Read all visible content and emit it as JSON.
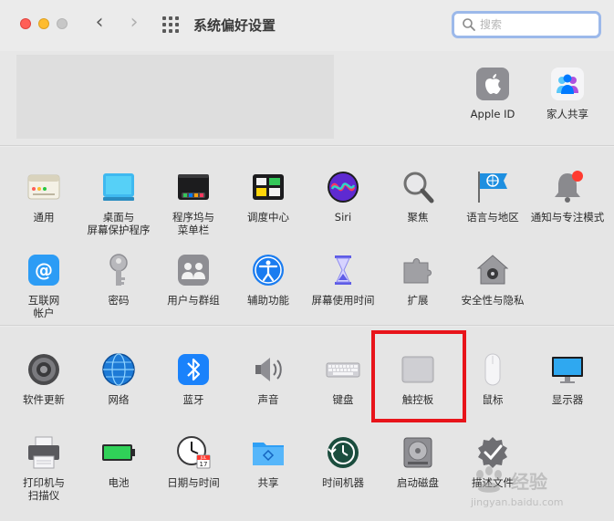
{
  "window": {
    "title": "系统偏好设置"
  },
  "search": {
    "placeholder": "搜索"
  },
  "account": {
    "items": [
      {
        "label": "Apple ID"
      },
      {
        "label": "家人共享"
      }
    ]
  },
  "section_personal": {
    "items": [
      {
        "label": "通用"
      },
      {
        "label": "桌面与\n屏幕保护程序"
      },
      {
        "label": "程序坞与\n菜单栏"
      },
      {
        "label": "调度中心"
      },
      {
        "label": "Siri"
      },
      {
        "label": "聚焦"
      },
      {
        "label": "语言与地区"
      },
      {
        "label": "通知与专注模式"
      },
      {
        "label": "互联网\n帐户"
      },
      {
        "label": "密码"
      },
      {
        "label": "用户与群组"
      },
      {
        "label": "辅助功能"
      },
      {
        "label": "屏幕使用时间"
      },
      {
        "label": "扩展"
      },
      {
        "label": "安全性与隐私"
      }
    ]
  },
  "section_hardware": {
    "items": [
      {
        "label": "软件更新"
      },
      {
        "label": "网络"
      },
      {
        "label": "蓝牙"
      },
      {
        "label": "声音"
      },
      {
        "label": "键盘"
      },
      {
        "label": "触控板"
      },
      {
        "label": "鼠标"
      },
      {
        "label": "显示器"
      },
      {
        "label": "打印机与\n扫描仪"
      },
      {
        "label": "电池"
      },
      {
        "label": "日期与时间"
      },
      {
        "label": "共享"
      },
      {
        "label": "时间机器"
      },
      {
        "label": "启动磁盘"
      },
      {
        "label": "描述文件"
      }
    ]
  },
  "calendar_icon": {
    "month": "JUL",
    "day": "17"
  },
  "watermark": {
    "brand": "经验",
    "url": "jingyan.baidu.com"
  },
  "colors": {
    "highlight": "#e8141a",
    "search_focus": "#9cb9ea"
  }
}
